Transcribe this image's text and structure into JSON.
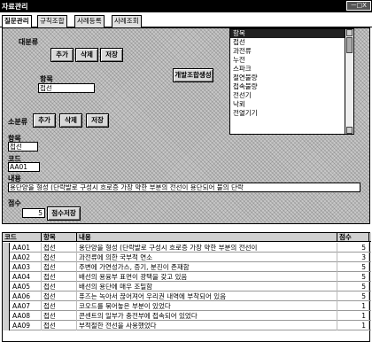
{
  "window": {
    "title": "자료관리",
    "sys_buttons": "ㅡ□X"
  },
  "tabs": [
    {
      "label": "질문관리"
    },
    {
      "label": "규칙조합"
    },
    {
      "label": "사례등록"
    },
    {
      "label": "사례조회"
    }
  ],
  "major": {
    "label": "대분류",
    "add": "추가",
    "del": "삭제",
    "save": "저장",
    "name_label": "항목",
    "name_value": "접선"
  },
  "combo_button": "개발조합생성",
  "minor": {
    "label": "소분류",
    "add": "추가",
    "del": "삭제",
    "save": "저장"
  },
  "form": {
    "item_label": "항목",
    "item_value": "접선",
    "code_label": "코드",
    "code_value": "AA01",
    "content_label": "내용",
    "content_value": "용단양을 형성 (단락발로 구성시 흐로증 가장 약한 부분의 전선이 용단되어 불의 단락",
    "score_label": "점수",
    "score_value": "5",
    "score_button": "점수저장"
  },
  "list": {
    "header": "항목",
    "items": [
      "접선",
      "과전류",
      "누전",
      "스파크",
      "절연불량",
      "접속불량",
      "전선기",
      "낙뢰",
      "전열기기"
    ]
  },
  "grid": {
    "headers": [
      "코드",
      "항목",
      "내용",
      "점수"
    ],
    "rows": [
      [
        "AA01",
        "접선",
        "용단양을 형성 (단락발로 구성시 흐로증 가장 약한 부분의 전선이",
        "5"
      ],
      [
        "AA02",
        "접선",
        "과전류에 의한 국부적 연소",
        "3"
      ],
      [
        "AA03",
        "접선",
        "주변에 가연성가스, 증기, 분진이 존재함",
        "5"
      ],
      [
        "AA04",
        "접선",
        "배선의 용융부 표면이 광택을 갖고 있음",
        "5"
      ],
      [
        "AA05",
        "접선",
        "배선의 용단에 매우 조밀함",
        "5"
      ],
      [
        "AA06",
        "접선",
        "퓨즈는 녹아서 끊어져어 우리권 내역에 부착되어 있음",
        "5"
      ],
      [
        "AA07",
        "접선",
        "코오드를 묶어놓은 부분이 있었다",
        "1"
      ],
      [
        "AA08",
        "접선",
        "콘센트의 일부가 충전부에 접속되어 있었다",
        "1"
      ],
      [
        "AA09",
        "접선",
        "부적절한 전선을 사용했었다",
        "1"
      ]
    ]
  }
}
